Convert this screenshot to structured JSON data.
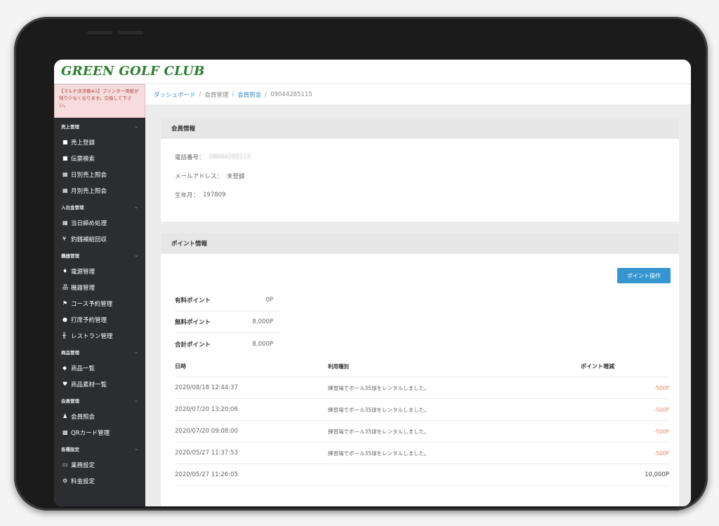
{
  "app": {
    "logo": "GREEN GOLF CLUB"
  },
  "alert": {
    "text": "【マルチ決済機#2】プリンター用紙が残り少なくなります。交換して下さい。"
  },
  "sidebar": {
    "sections": [
      {
        "title": "売上管理",
        "items": [
          {
            "icon": "receipt",
            "label": "売上登録"
          },
          {
            "icon": "receipt",
            "label": "伝票検索"
          },
          {
            "icon": "calendar",
            "label": "日別売上照会"
          },
          {
            "icon": "calendar",
            "label": "月別売上照会"
          }
        ]
      },
      {
        "title": "入出金管理",
        "items": [
          {
            "icon": "calendar",
            "label": "当日締め処理"
          },
          {
            "icon": "yen",
            "label": "釣銭補給回収"
          }
        ]
      },
      {
        "title": "機器管理",
        "items": [
          {
            "icon": "plug",
            "label": "電源管理"
          },
          {
            "icon": "sitemap",
            "label": "機器管理"
          },
          {
            "icon": "flag",
            "label": "コース予約管理"
          },
          {
            "icon": "target",
            "label": "打席予約管理"
          },
          {
            "icon": "cutlery",
            "label": "レストラン管理"
          }
        ]
      },
      {
        "title": "商品管理",
        "items": [
          {
            "icon": "tags",
            "label": "商品一覧"
          },
          {
            "icon": "gem",
            "label": "商品素材一覧"
          }
        ]
      },
      {
        "title": "会員管理",
        "items": [
          {
            "icon": "user",
            "label": "会員照会"
          },
          {
            "icon": "qrcode",
            "label": "QRカード管理"
          }
        ]
      },
      {
        "title": "各種設定",
        "items": [
          {
            "icon": "monitor",
            "label": "業務設定"
          },
          {
            "icon": "gear",
            "label": "料金設定"
          }
        ]
      }
    ]
  },
  "breadcrumb": {
    "items": [
      "ダッシュボード",
      "会員管理",
      "会員照会",
      "09044285115"
    ]
  },
  "member_info": {
    "title": "会員情報",
    "phone_label": "電話番号：",
    "phone_value": "09044285115",
    "email_label": "メールアドレス：",
    "email_value": "未登録",
    "birth_label": "生年月：",
    "birth_value": "197809"
  },
  "point_info": {
    "title": "ポイント情報",
    "button_label": "ポイント操作",
    "paid_label": "有料ポイント",
    "paid_value": "0P",
    "free_label": "無料ポイント",
    "free_value": "8,000P",
    "total_label": "合計ポイント",
    "total_value": "8,000P",
    "history_headers": [
      "日時",
      "利用種別",
      "ポイント増減"
    ],
    "history": [
      {
        "datetime": "2020/08/18 12:44:37",
        "type": "練習場でボール35球をレンタルしました。",
        "delta": "-500P"
      },
      {
        "datetime": "2020/07/20 13:20:06",
        "type": "練習場でボール35球をレンタルしました。",
        "delta": "-500P"
      },
      {
        "datetime": "2020/07/20 09:08:00",
        "type": "練習場でボール35球をレンタルしました。",
        "delta": "-500P"
      },
      {
        "datetime": "2020/05/27 11:37:53",
        "type": "練習場でボール35球をレンタルしました。",
        "delta": "-500P"
      },
      {
        "datetime": "2020/05/27 11:26:05",
        "type": "",
        "delta": "10,000P"
      }
    ]
  },
  "colors": {
    "brand": "#2e7d32",
    "sidebar_bg": "#2b2d30",
    "accent": "#3596cf",
    "negative": "#e08a6a"
  }
}
